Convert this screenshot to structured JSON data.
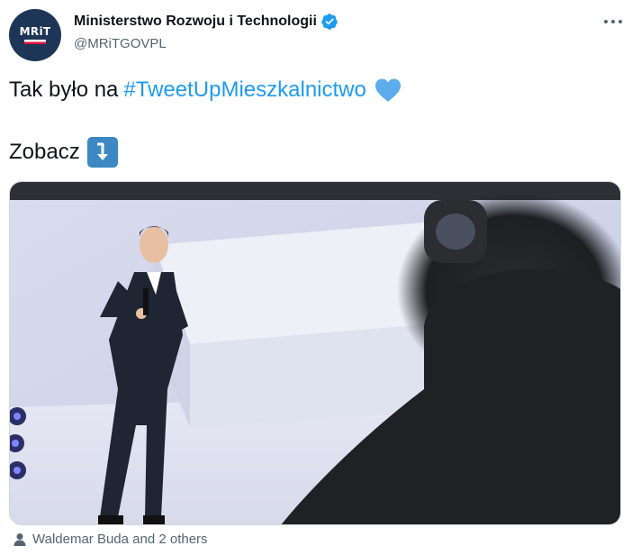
{
  "account": {
    "avatar_text": "MRiT",
    "display_name": "Ministerstwo Rozwoju i Technologii",
    "handle": "@MRiTGOVPL",
    "verified_icon": "verified-badge-icon"
  },
  "tweet": {
    "text_prefix": "Tak było na",
    "hashtag": "#TweetUpMieszkalnictwo",
    "emoji_heart": "blue-heart-icon",
    "line2_text": "Zobacz",
    "emoji_arrow": "arrow-down-right-icon"
  },
  "media": {
    "description_icon": "photo"
  },
  "tags": {
    "text": "Waldemar Buda and 2 others",
    "icon": "person-icon"
  },
  "colors": {
    "accent": "#1d9bf0",
    "secondary_text": "#536471",
    "primary_text": "#0f1419"
  }
}
